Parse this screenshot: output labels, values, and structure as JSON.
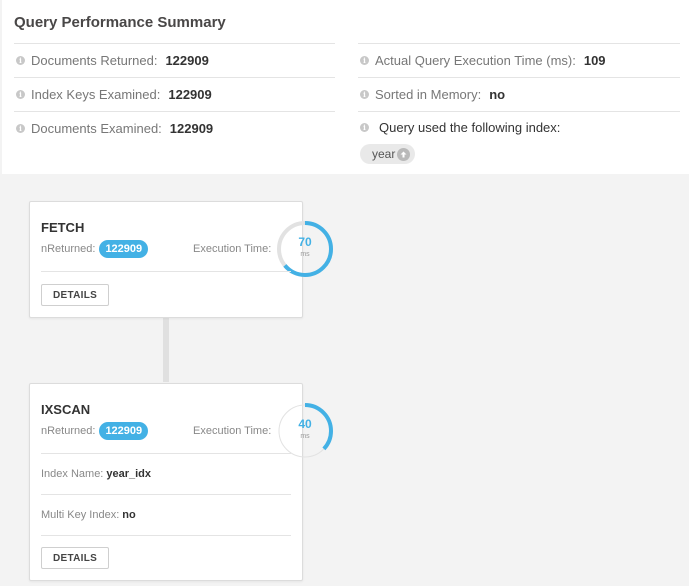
{
  "summary": {
    "title": "Query Performance Summary",
    "left": [
      {
        "label": "Documents Returned:",
        "value": "122909"
      },
      {
        "label": "Index Keys Examined:",
        "value": "122909"
      },
      {
        "label": "Documents Examined:",
        "value": "122909"
      }
    ],
    "right": [
      {
        "label": "Actual Query Execution Time (ms):",
        "value": "109"
      },
      {
        "label": "Sorted in Memory:",
        "value": "no"
      }
    ],
    "index_label": "Query used the following index:",
    "index_name": "year"
  },
  "stages": [
    {
      "name": "FETCH",
      "nreturned_label": "nReturned:",
      "nreturned": "122909",
      "exec_label": "Execution Time:",
      "exec_time": "70",
      "exec_unit": "ms",
      "gauge_fraction": 0.64,
      "details_label": "DETAILS"
    },
    {
      "name": "IXSCAN",
      "nreturned_label": "nReturned:",
      "nreturned": "122909",
      "exec_label": "Execution Time:",
      "exec_time": "40",
      "exec_unit": "ms",
      "gauge_fraction": 0.37,
      "index_name_label": "Index Name:",
      "index_name": "year_idx",
      "multikey_label": "Multi Key Index:",
      "multikey": "no",
      "details_label": "DETAILS"
    }
  ],
  "colors": {
    "accent": "#43b1e5",
    "gauge_track": "#e2e2e2"
  }
}
